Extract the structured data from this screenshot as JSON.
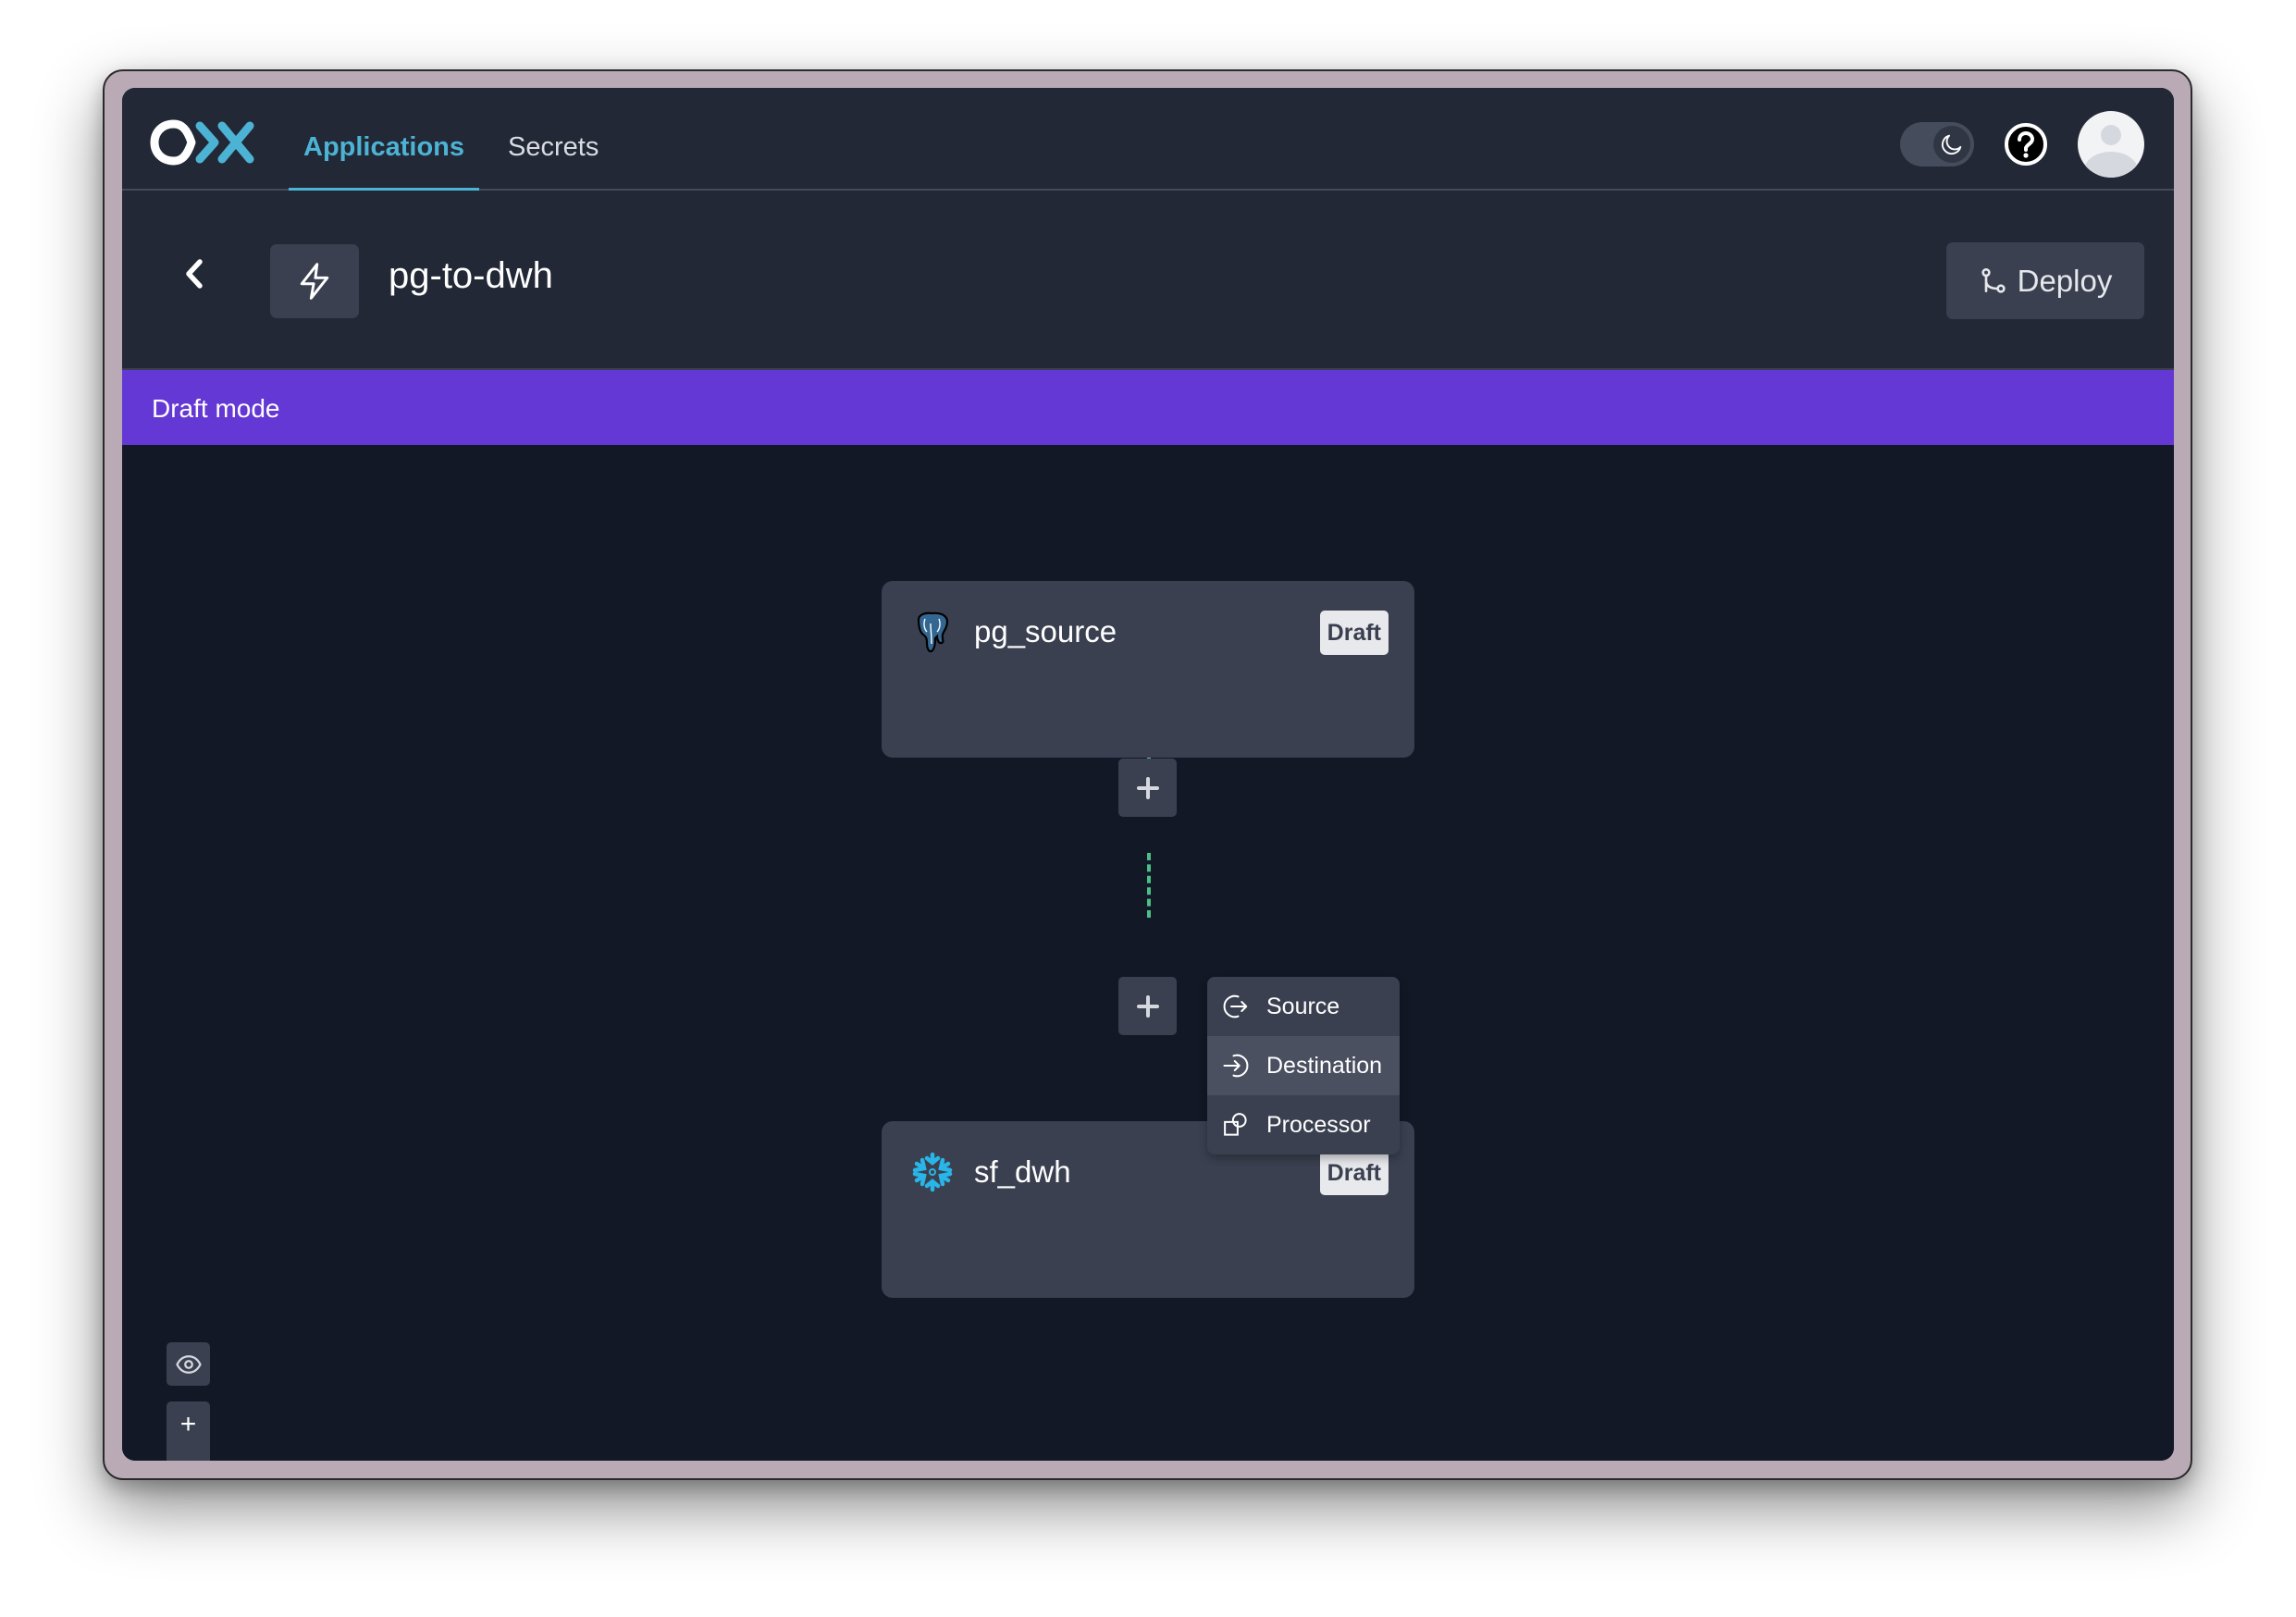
{
  "nav": {
    "logo": "OX",
    "tabs": [
      {
        "label": "Applications",
        "active": true
      },
      {
        "label": "Secrets",
        "active": false
      }
    ],
    "theme_mode": "dark",
    "icons": {
      "theme": "moon-icon",
      "help": "help-circle-icon",
      "avatar": "user-avatar-icon"
    }
  },
  "header": {
    "back_icon": "chevron-left-icon",
    "app_icon": "lightning-bolt-icon",
    "title": "pg-to-dwh",
    "deploy_label": "Deploy",
    "deploy_icon": "git-branch-icon"
  },
  "banner": {
    "text": "Draft mode",
    "color": "#6438d4"
  },
  "pipeline": {
    "nodes": [
      {
        "name": "pg_source",
        "badge": "Draft",
        "icon": "postgresql-elephant-icon"
      },
      {
        "name": "sf_dwh",
        "badge": "Draft",
        "icon": "snowflake-icon"
      }
    ],
    "edge_color": "#4cbf86",
    "add_button_label": "+"
  },
  "add_menu": {
    "items": [
      {
        "label": "Source",
        "icon": "source-arrow-out-icon",
        "highlighted": false
      },
      {
        "label": "Destination",
        "icon": "destination-arrow-in-icon",
        "highlighted": true
      },
      {
        "label": "Processor",
        "icon": "processor-shapes-icon",
        "highlighted": false
      }
    ]
  },
  "canvas_controls": {
    "visibility_icon": "eye-icon",
    "zoom_in": "+",
    "zoom_out": "-"
  }
}
